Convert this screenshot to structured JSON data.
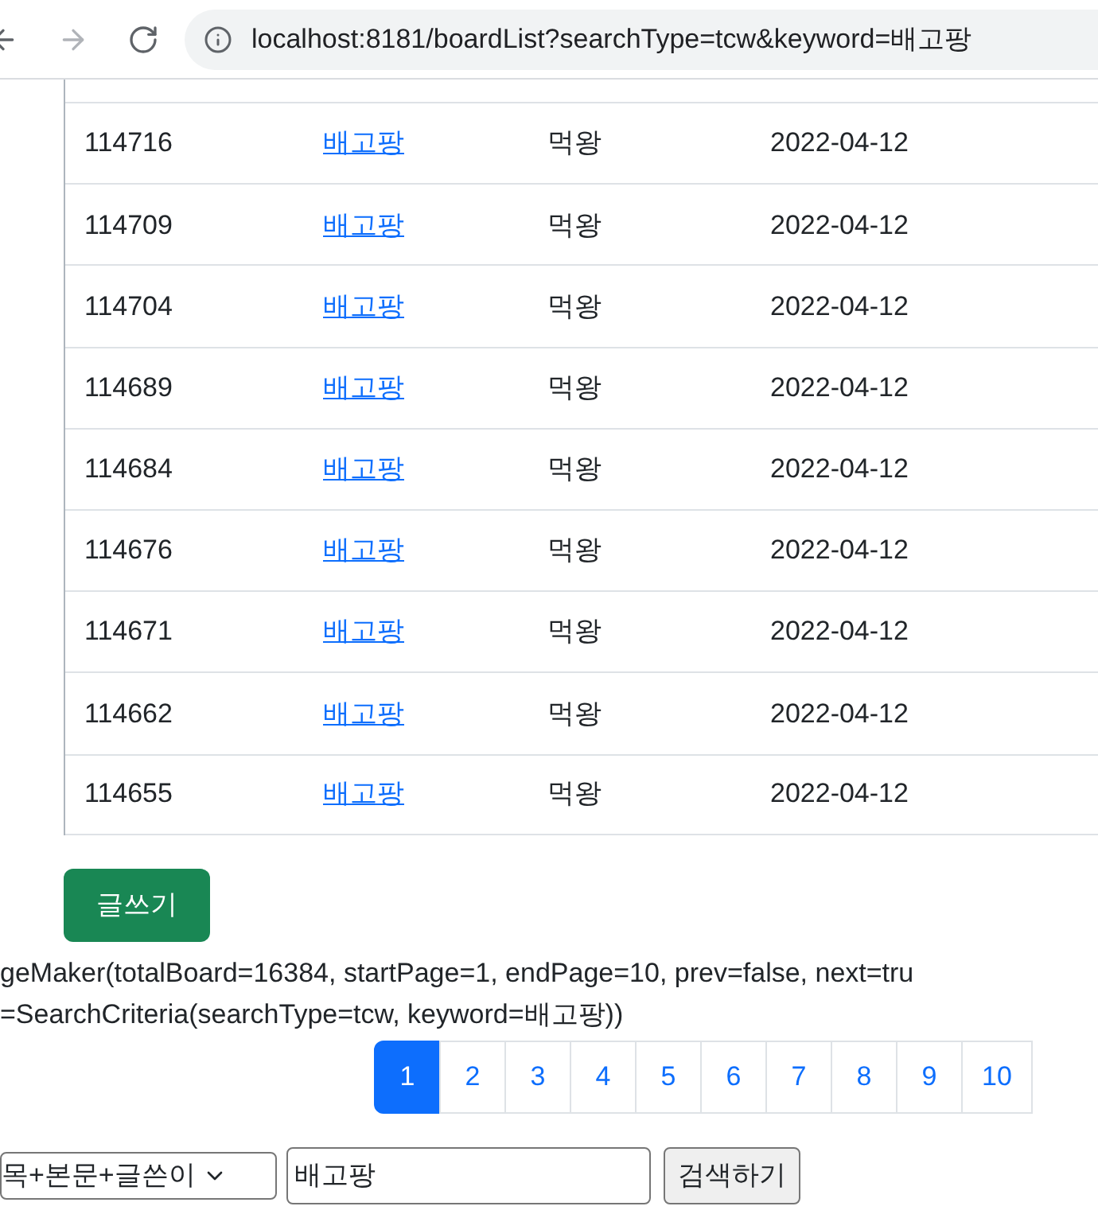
{
  "browser": {
    "url": "localhost:8181/boardList?searchType=tcw&keyword=배고팡"
  },
  "rows": [
    {
      "id": "114716",
      "title": "배고팡",
      "writer": "먹왕",
      "date": "2022-04-12"
    },
    {
      "id": "114709",
      "title": "배고팡",
      "writer": "먹왕",
      "date": "2022-04-12"
    },
    {
      "id": "114704",
      "title": "배고팡",
      "writer": "먹왕",
      "date": "2022-04-12"
    },
    {
      "id": "114689",
      "title": "배고팡",
      "writer": "먹왕",
      "date": "2022-04-12"
    },
    {
      "id": "114684",
      "title": "배고팡",
      "writer": "먹왕",
      "date": "2022-04-12"
    },
    {
      "id": "114676",
      "title": "배고팡",
      "writer": "먹왕",
      "date": "2022-04-12"
    },
    {
      "id": "114671",
      "title": "배고팡",
      "writer": "먹왕",
      "date": "2022-04-12"
    },
    {
      "id": "114662",
      "title": "배고팡",
      "writer": "먹왕",
      "date": "2022-04-12"
    },
    {
      "id": "114655",
      "title": "배고팡",
      "writer": "먹왕",
      "date": "2022-04-12"
    }
  ],
  "write_button": "글쓰기",
  "debug_lines": [
    "geMaker(totalBoard=16384, startPage=1, endPage=10, prev=false, next=tru",
    "=SearchCriteria(searchType=tcw, keyword=배고팡))"
  ],
  "pages": [
    {
      "label": "1",
      "selected": true
    },
    {
      "label": "2",
      "selected": false
    },
    {
      "label": "3",
      "selected": false
    },
    {
      "label": "4",
      "selected": false
    },
    {
      "label": "5",
      "selected": false
    },
    {
      "label": "6",
      "selected": false
    },
    {
      "label": "7",
      "selected": false
    },
    {
      "label": "8",
      "selected": false
    },
    {
      "label": "9",
      "selected": false
    },
    {
      "label": "10",
      "selected": false
    }
  ],
  "search": {
    "type": "목+본문+글쓴이",
    "keyword": "배고팡",
    "button": "검색하기"
  }
}
